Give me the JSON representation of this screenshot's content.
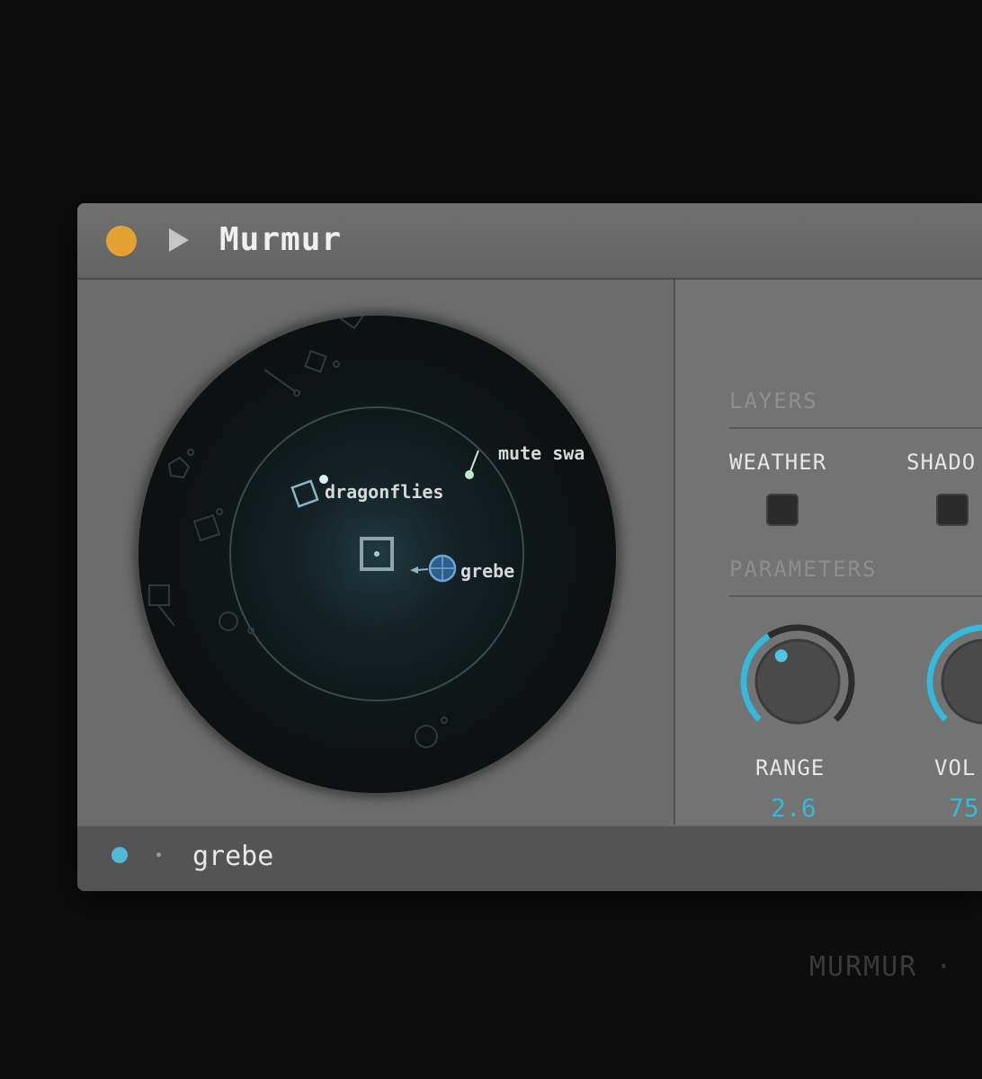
{
  "window": {
    "title": "Murmur"
  },
  "radar": {
    "sources": [
      {
        "name": "dragonflies",
        "label": "dragonflies"
      },
      {
        "name": "mute-swan",
        "label": "mute swa"
      },
      {
        "name": "grebe",
        "label": "grebe"
      }
    ]
  },
  "controls": {
    "layers_title": "LAYERS",
    "layers": [
      {
        "label": "WEATHER",
        "checked": false
      },
      {
        "label": "SHADO",
        "checked": false
      }
    ],
    "parameters_title": "PARAMETERS",
    "params": [
      {
        "label": "RANGE",
        "value": "2.6",
        "level": 0.38
      },
      {
        "label": "VOL",
        "value": "75",
        "level": 0.75
      }
    ]
  },
  "status": {
    "selected": "grebe"
  },
  "footer": {
    "brand": "MURMUR  ·"
  },
  "colors": {
    "power": "#e5a234",
    "accent": "#38b8d8",
    "window_bg": "#6a6a6a"
  }
}
